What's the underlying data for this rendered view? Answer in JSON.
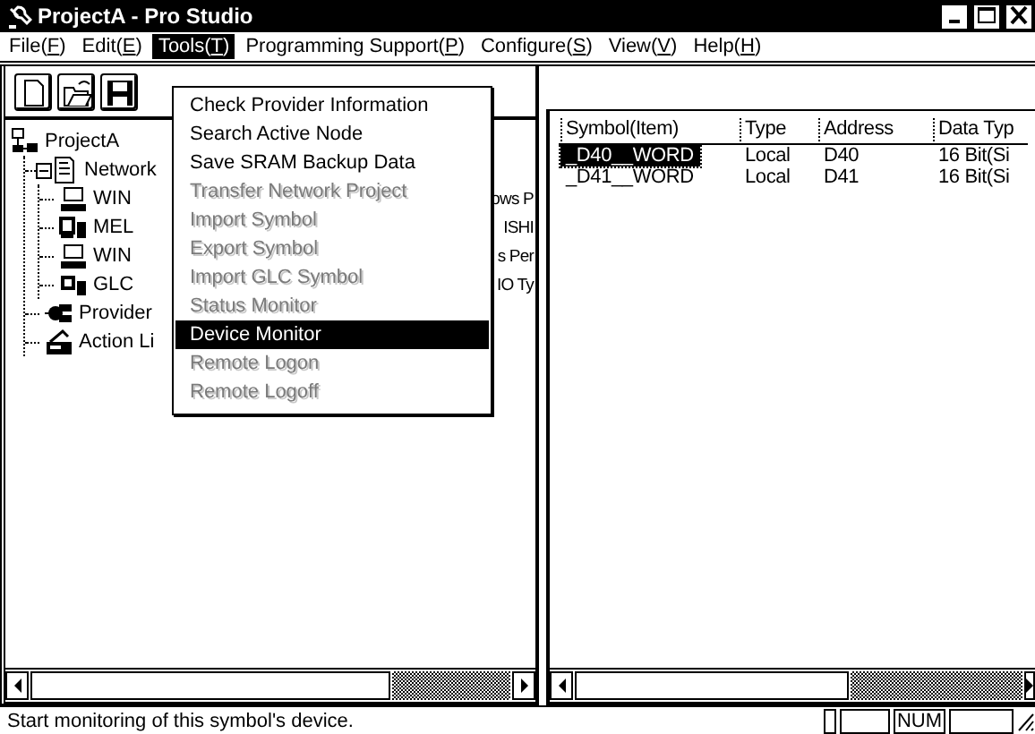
{
  "window": {
    "title": "ProjectA - Pro Studio"
  },
  "menu_bar": [
    {
      "text": "File(",
      "mnemonic": "F",
      "end": ")",
      "selected": false
    },
    {
      "text": "Edit(",
      "mnemonic": "E",
      "end": ")",
      "selected": false
    },
    {
      "text": "Tools(",
      "mnemonic": "T",
      "end": ")",
      "selected": true
    },
    {
      "text": "Programming Support(",
      "mnemonic": "P",
      "end": ")",
      "selected": false
    },
    {
      "text": "Configure(",
      "mnemonic": "S",
      "end": ")",
      "selected": false
    },
    {
      "text": "View(",
      "mnemonic": "V",
      "end": ")",
      "selected": false
    },
    {
      "text": "Help(",
      "mnemonic": "H",
      "end": ")",
      "selected": false
    }
  ],
  "toolbar": [
    {
      "kind": "new"
    },
    {
      "kind": "open"
    },
    {
      "kind": "save"
    }
  ],
  "tree": [
    {
      "label": "ProjectA",
      "kind": "project",
      "children": [
        {
          "label": "Network",
          "kind": "network",
          "expanded": true,
          "children": [
            {
              "label": "WIN",
              "tail": "ows P",
              "kind": "pc"
            },
            {
              "label": "MEL",
              "tail": "ISHI",
              "kind": "plc"
            },
            {
              "label": "WIN",
              "tail": "s Per",
              "kind": "pc"
            },
            {
              "label": "GLC",
              "tail": "IO Ty",
              "kind": "glc"
            }
          ]
        },
        {
          "label": "Provider",
          "kind": "provider"
        },
        {
          "label": "Action Li",
          "kind": "action"
        }
      ]
    }
  ],
  "tools_menu": [
    {
      "label": "Check Provider Information",
      "disabled": false,
      "selected": false
    },
    {
      "label": "Search Active Node",
      "disabled": false,
      "selected": false
    },
    {
      "label": "Save SRAM Backup Data",
      "disabled": false,
      "selected": false
    },
    {
      "label": "Transfer Network Project",
      "disabled": true,
      "selected": false
    },
    {
      "label": "Import Symbol",
      "disabled": true,
      "selected": false
    },
    {
      "label": "Export Symbol",
      "disabled": true,
      "selected": false
    },
    {
      "label": "Import GLC Symbol",
      "disabled": true,
      "selected": false
    },
    {
      "label": "Status Monitor",
      "disabled": true,
      "selected": false
    },
    {
      "label": "Device Monitor",
      "disabled": false,
      "selected": true
    },
    {
      "label": "Remote Logon",
      "disabled": true,
      "selected": false
    },
    {
      "label": "Remote Logoff",
      "disabled": true,
      "selected": false
    }
  ],
  "symbol_list": {
    "columns": [
      "Symbol(Item)",
      "Type",
      "Address",
      "Data Typ"
    ],
    "rows": [
      {
        "cells": [
          "_D40__WORD",
          "Local",
          "D40",
          "16 Bit(Si"
        ],
        "selected": true
      },
      {
        "cells": [
          "_D41__WORD",
          "Local",
          "D41",
          "16 Bit(Si"
        ],
        "selected": false
      }
    ]
  },
  "status_bar": {
    "text": "Start monitoring of this symbol's device.",
    "indicators": [
      "NUM"
    ]
  }
}
